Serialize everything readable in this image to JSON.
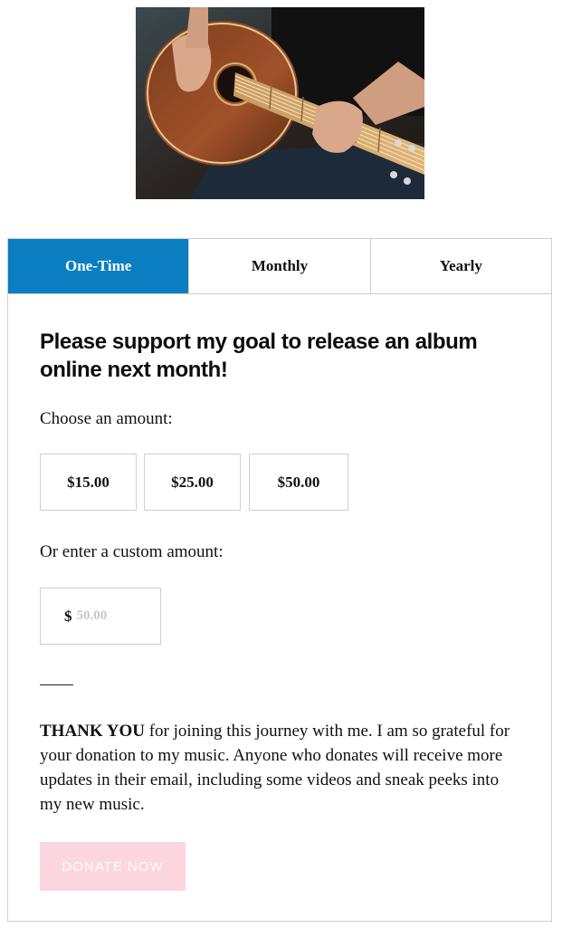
{
  "hero": {
    "alt": "Person playing an acoustic guitar"
  },
  "tabs": [
    {
      "label": "One-Time",
      "active": true
    },
    {
      "label": "Monthly",
      "active": false
    },
    {
      "label": "Yearly",
      "active": false
    }
  ],
  "form": {
    "headline": "Please support my goal to release an album online next month!",
    "choose_label": "Choose an amount:",
    "amounts": [
      "$15.00",
      "$25.00",
      "$50.00"
    ],
    "custom_label": "Or enter a custom amount:",
    "custom": {
      "currency": "$",
      "placeholder": "50.00",
      "value": ""
    },
    "thanks_bold": "THANK YOU",
    "thanks_text": " for joining this journey with me. I am so grateful for your donation to my music. Anyone who donates will receive more updates in their email, including some videos and sneak peeks into my new music.",
    "donate_label": "DONATE NOW"
  },
  "colors": {
    "accent": "#0a7ec1",
    "donate_button": "#fbd6de",
    "border": "#cfcfcf"
  },
  "icons": {
    "hero_image": "guitar-photo"
  }
}
